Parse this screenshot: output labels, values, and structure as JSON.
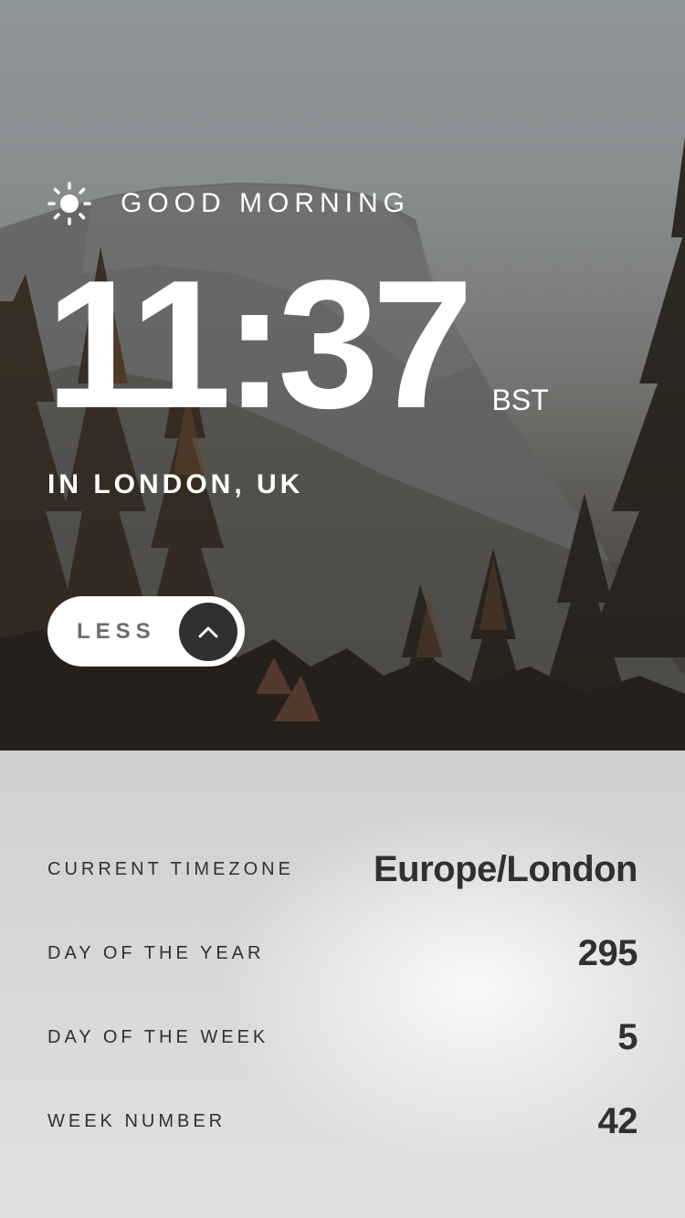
{
  "greeting": {
    "icon": "sun-icon",
    "text": "GOOD MORNING"
  },
  "clock": {
    "time": "11:37",
    "zone": "BST"
  },
  "location": "IN LONDON, UK",
  "toggle": {
    "label": "LESS",
    "icon": "chevron-up-icon"
  },
  "details": [
    {
      "label": "CURRENT TIMEZONE",
      "value": "Europe/London"
    },
    {
      "label": "DAY OF THE YEAR",
      "value": "295"
    },
    {
      "label": "DAY OF THE WEEK",
      "value": "5"
    },
    {
      "label": "WEEK NUMBER",
      "value": "42"
    }
  ],
  "colors": {
    "text_light": "#ffffff",
    "text_dark": "#303030",
    "button_bg": "#ffffff",
    "arrow_bg": "#303030",
    "panel_bg": "#d9dadb"
  }
}
